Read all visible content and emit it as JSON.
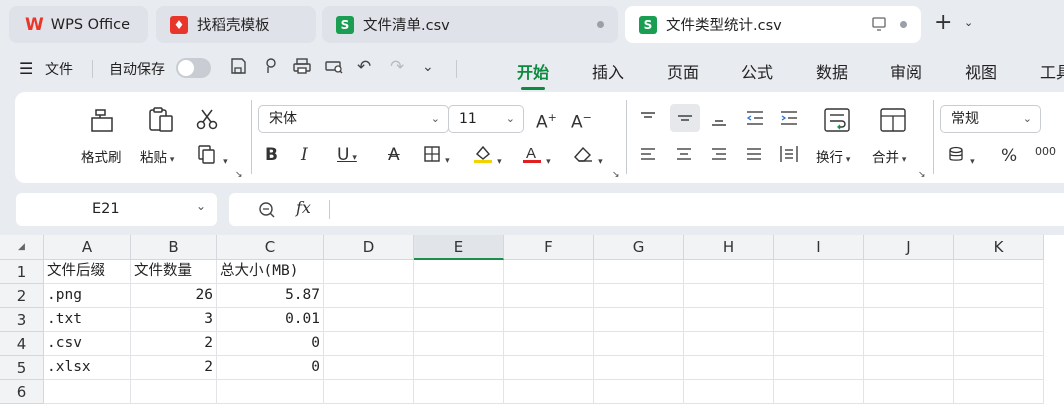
{
  "tabs": [
    {
      "label": "WPS Office",
      "icon": "wps-logo-icon"
    },
    {
      "label": "找稻壳模板",
      "icon": "docer-icon"
    },
    {
      "label": "文件清单.csv",
      "icon": "spreadsheet-icon"
    },
    {
      "label": "文件类型统计.csv",
      "icon": "spreadsheet-icon"
    }
  ],
  "menu": {
    "file_label": "文件",
    "autosave_label": "自动保存",
    "ribbon_tabs": [
      "开始",
      "插入",
      "页面",
      "公式",
      "数据",
      "审阅",
      "视图",
      "工具"
    ]
  },
  "ribbon": {
    "format_painter": "格式刷",
    "paste": "粘贴",
    "font_name": "宋体",
    "font_size": "11",
    "wrap": "换行",
    "merge": "合并",
    "number_format": "常规",
    "percent_symbol": "%",
    "thousands_symbol": "000"
  },
  "formula_bar": {
    "cell_ref": "E21",
    "fx": "fx",
    "content": ""
  },
  "sheet": {
    "columns": [
      "A",
      "B",
      "C",
      "D",
      "E",
      "F",
      "G",
      "H",
      "I",
      "J",
      "K"
    ],
    "rows": [
      "1",
      "2",
      "3",
      "4",
      "5",
      "6"
    ],
    "cells": [
      [
        "文件后缀",
        "文件数量",
        "总大小(MB)"
      ],
      [
        ".png",
        "26",
        "5.87"
      ],
      [
        ".txt",
        "3",
        "0.01"
      ],
      [
        ".csv",
        "2",
        "0"
      ],
      [
        ".xlsx",
        "2",
        "0"
      ]
    ]
  },
  "colors": {
    "accent": "#0c8a3e",
    "wps_red": "#e8372a",
    "sheet_green": "#1a9e52",
    "font_color": "#e02020",
    "highlight": "#f2d200"
  }
}
